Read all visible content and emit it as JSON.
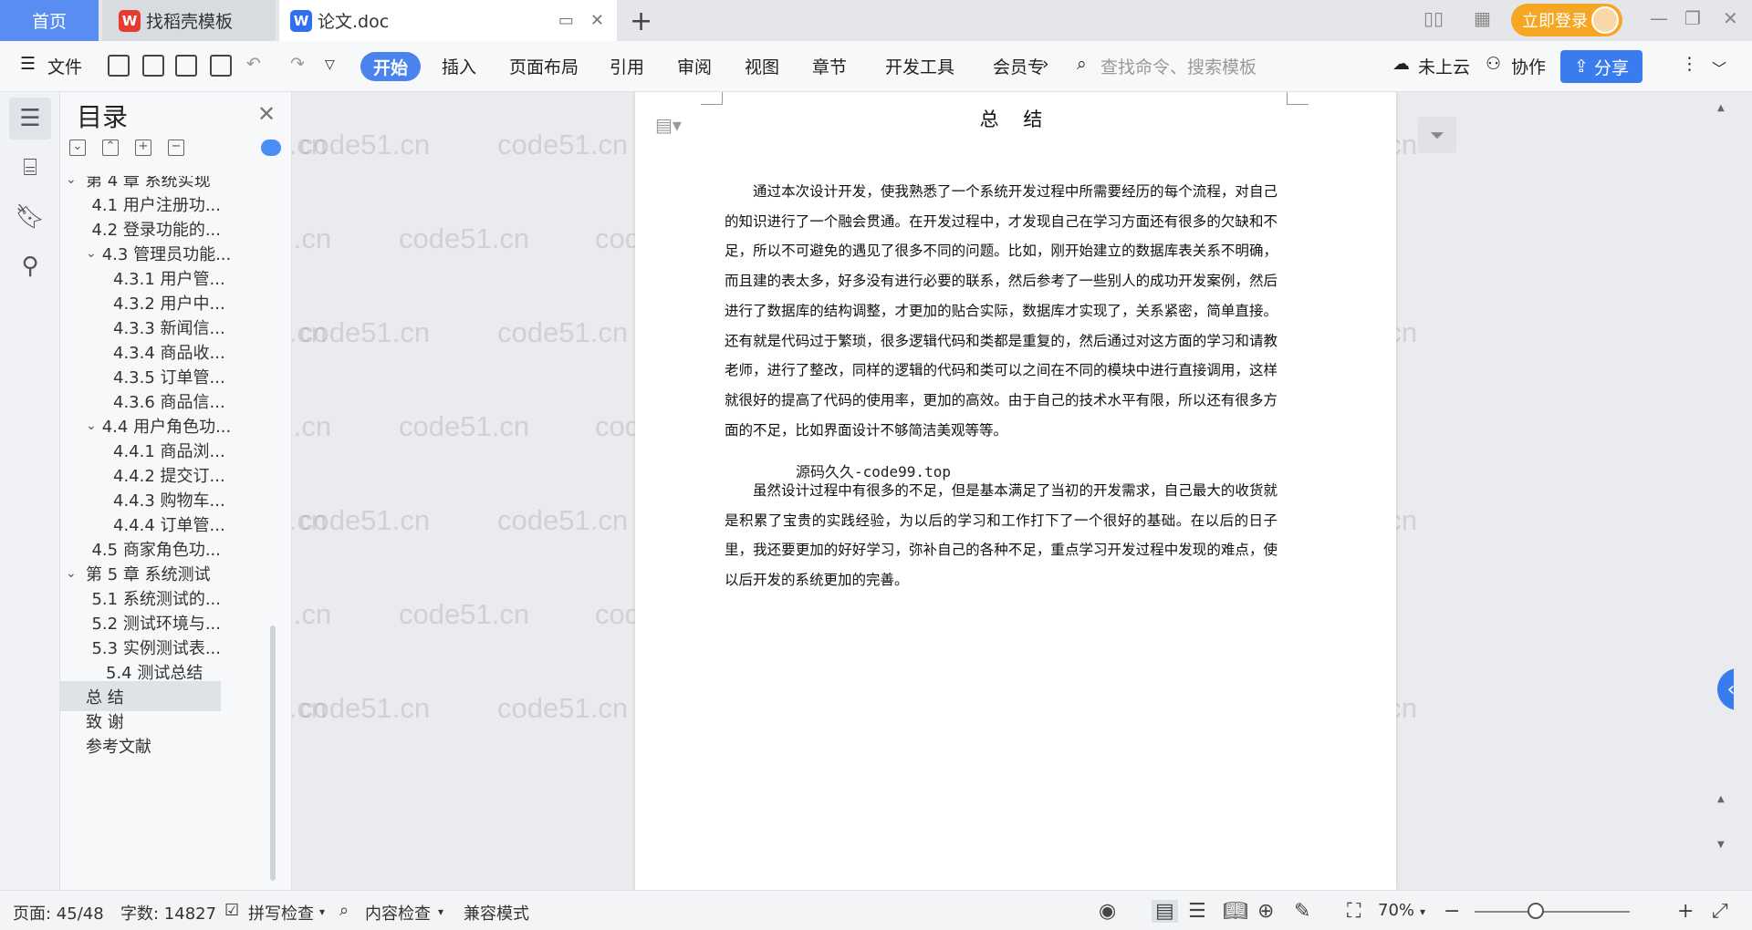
{
  "tabs": {
    "home": "首页",
    "doke": "找稻壳模板",
    "doc": "论文.doc",
    "login": "立即登录"
  },
  "ribbon": {
    "file": "文件",
    "start": "开始",
    "items": [
      "插入",
      "页面布局",
      "引用",
      "审阅",
      "视图",
      "章节",
      "开发工具",
      "会员专"
    ],
    "search_placeholder": "查找命令、搜索模板",
    "cloud": "未上云",
    "collab": "协作",
    "share": "分享"
  },
  "toc": {
    "title": "目录",
    "items": [
      {
        "label": "第 4 章 系统实现",
        "level": 1,
        "expanded": true
      },
      {
        "label": "4.1 用户注册功...",
        "level": 2
      },
      {
        "label": "4.2 登录功能的...",
        "level": 2
      },
      {
        "label": "4.3 管理员功能...",
        "level": 2,
        "expanded": true
      },
      {
        "label": "4.3.1 用户管...",
        "level": 3
      },
      {
        "label": "4.3.2  用户中...",
        "level": 3
      },
      {
        "label": "4.3.3 新闻信...",
        "level": 3
      },
      {
        "label": "4.3.4  商品收...",
        "level": 3
      },
      {
        "label": "4.3.5  订单管...",
        "level": 3
      },
      {
        "label": "4.3.6  商品信...",
        "level": 3
      },
      {
        "label": "4.4 用户角色功...",
        "level": 2,
        "expanded": true
      },
      {
        "label": "4.4.1 商品浏...",
        "level": 3
      },
      {
        "label": "4.4.2 提交订...",
        "level": 3
      },
      {
        "label": "4.4.3 购物车...",
        "level": 3
      },
      {
        "label": "4.4.4 订单管...",
        "level": 3
      },
      {
        "label": "4.5 商家角色功...",
        "level": 2
      },
      {
        "label": "第 5 章  系统测试",
        "level": 1,
        "expanded": true
      },
      {
        "label": "5.1 系统测试的...",
        "level": 2
      },
      {
        "label": "5.2 测试环境与...",
        "level": 2
      },
      {
        "label": "5.3 实例测试表...",
        "level": 2
      },
      {
        "label": "5.4 测试总结",
        "level": 2
      },
      {
        "label": "总  结",
        "level": 1,
        "selected": true
      },
      {
        "label": "致  谢",
        "level": 1
      },
      {
        "label": "参考文献",
        "level": 1
      }
    ]
  },
  "document": {
    "title": "总 结",
    "para1": "通过本次设计开发，使我熟悉了一个系统开发过程中所需要经历的每个流程，对自己的知识进行了一个融会贯通。在开发过程中，才发现自己在学习方面还有很多的欠缺和不足，所以不可避免的遇见了很多不同的问题。比如，刚开始建立的数据库表关系不明确，而且建的表太多，好多没有进行必要的联系，然后参考了一些别人的成功开发案例，然后进行了数据库的结构调整，才更加的贴合实际，数据库才实现了，关系紧密，简单直接。还有就是代码过于繁琐，很多逻辑代码和类都是重复的，然后通过对这方面的学习和请教老师，进行了整改，同样的逻辑的代码和类可以之间在不同的模块中进行直接调用，这样就很好的提高了代码的使用率，更加的高效。由于自己的技术水平有限，所以还有很多方面的不足，比如界面设计不够简洁美观等等。",
    "para2": "虽然设计过程中有很多的不足，但是基本满足了当初的开发需求，自己最大的收货就是积累了宝贵的实践经验，为以后的学习和工作打下了一个很好的基础。在以后的日子里，我还要更加的好好学习，弥补自己的各种不足，重点学习开发过程中发现的难点，使以后开发的系统更加的完善。",
    "overlay_text": "源码久久-code99.top"
  },
  "watermark": "code51.cn",
  "status": {
    "page": "页面: 45/48",
    "words": "字数: 14827",
    "spell": "拼写检查",
    "content_check": "内容检查",
    "compat": "兼容模式",
    "zoom": "70%"
  }
}
